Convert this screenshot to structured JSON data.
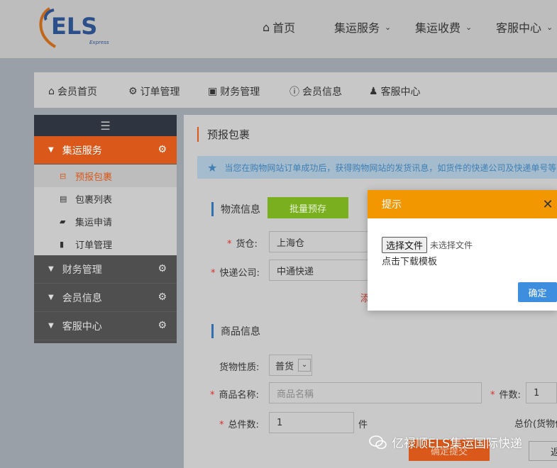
{
  "header": {
    "logo_text": "ELS",
    "logo_sub": "Express",
    "nav": [
      {
        "label": "首页",
        "icon": "home-icon"
      },
      {
        "label": "集运服务",
        "icon": "chevron-down-icon"
      },
      {
        "label": "集运收费",
        "icon": "chevron-down-icon"
      },
      {
        "label": "客服中心",
        "icon": "chevron-down-icon"
      }
    ]
  },
  "subnav": [
    {
      "label": "会员首页",
      "icon": "home-icon"
    },
    {
      "label": "订单管理",
      "icon": "gear-icon"
    },
    {
      "label": "财务管理",
      "icon": "money-icon"
    },
    {
      "label": "会员信息",
      "icon": "info-icon"
    },
    {
      "label": "客服中心",
      "icon": "user-icon"
    }
  ],
  "sidebar": {
    "groups": [
      {
        "label": "集运服务",
        "active": true,
        "items": [
          {
            "label": "预报包裹",
            "icon": "inbox-icon",
            "current": true
          },
          {
            "label": "包裹列表",
            "icon": "list-icon"
          },
          {
            "label": "集运申请",
            "icon": "truck-icon"
          },
          {
            "label": "订单管理",
            "icon": "book-icon"
          }
        ]
      },
      {
        "label": "财务管理"
      },
      {
        "label": "会员信息"
      },
      {
        "label": "客服中心"
      }
    ]
  },
  "main": {
    "breadcrumb": "预报包裹",
    "notice": "当您在购物网站订单成功后，获得购物网站的发货讯息，如货件的快递公司及快递单号等",
    "logistics_title": "物流信息",
    "batch_button": "批量预存",
    "warehouse_label": "货仓:",
    "warehouse_value": "上海仓",
    "courier_label": "快递公司:",
    "courier_value": "中通快递",
    "add_link": "添",
    "goods_title": "商品信息",
    "nature_label": "货物性质:",
    "nature_value": "普货",
    "name_label": "商品名称:",
    "name_placeholder": "商品名稱",
    "count_label": "件数:",
    "count_value": "1",
    "total_count_label": "总件数:",
    "total_count_value": "1",
    "unit": "件",
    "total_price_label": "总价(货物价",
    "submit_button": "确定提交",
    "back_button": "返"
  },
  "modal": {
    "title": "提示",
    "file_button": "选择文件",
    "file_status": "未选择文件",
    "template_link": "点击下载模板",
    "ok_button": "确定"
  },
  "watermark": "亿禄顺ELS集运国际快递",
  "colors": {
    "accent_orange": "#d9581a",
    "modal_header": "#f39700",
    "primary_blue": "#3e8ee0",
    "green": "#7aaf1f"
  }
}
